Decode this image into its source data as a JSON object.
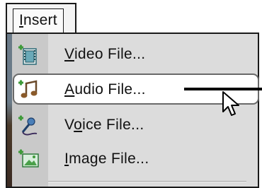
{
  "menu": {
    "title": "Insert",
    "title_accel": "I",
    "title_rest": "nsert"
  },
  "items": [
    {
      "label": "Video File...",
      "accel": "V",
      "before": "",
      "rest": "ideo File...",
      "icon": "video-file-icon"
    },
    {
      "label": "Audio File...",
      "accel": "A",
      "before": "",
      "rest": "udio File...",
      "icon": "audio-file-icon",
      "highlighted": true
    },
    {
      "label": "Voice File...",
      "accel": "o",
      "before": "V",
      "rest": "ice File...",
      "icon": "voice-file-icon"
    },
    {
      "label": "Image File...",
      "accel": "I",
      "before": "",
      "rest": "mage File...",
      "icon": "image-file-icon"
    }
  ],
  "colors": {
    "menu_bg": "#dcdcdc",
    "gutter_bg": "#c9c9c9",
    "highlight_bg": "#ffffff",
    "icon_green": "#3f9a3a",
    "icon_teal": "#2e6b78"
  }
}
